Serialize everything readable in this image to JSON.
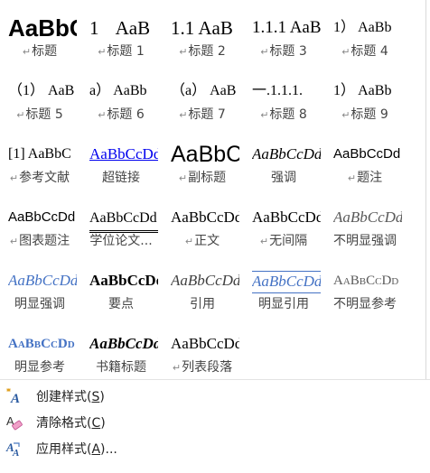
{
  "gallery": {
    "paragraph_mark": "↵",
    "styles": [
      {
        "preview": "AaBbC",
        "label": "标题",
        "mark": true
      },
      {
        "preview": "1 AaB",
        "label": "标题 1",
        "mark": true
      },
      {
        "preview": "1.1 AaB",
        "label": "标题 2",
        "mark": true
      },
      {
        "preview": "1.1.1 AaB",
        "label": "标题 3",
        "mark": true
      },
      {
        "preview": "1） AaBb",
        "label": "标题 4",
        "mark": true
      },
      {
        "preview": "（1） AaB",
        "label": "标题 5",
        "mark": true
      },
      {
        "preview": "a） AaBb",
        "label": "标题 6",
        "mark": true
      },
      {
        "preview": "（a） AaB",
        "label": "标题 7",
        "mark": true
      },
      {
        "preview": "一.1.1.1.",
        "label": "标题 8",
        "mark": true
      },
      {
        "preview": "1） AaBb",
        "label": "标题 9",
        "mark": true
      },
      {
        "preview": "[1] AaBbC",
        "label": "参考文献",
        "mark": true
      },
      {
        "preview": "AaBbCcDd",
        "label": "超链接",
        "mark": false
      },
      {
        "preview": "AaBbC",
        "label": "副标题",
        "mark": true
      },
      {
        "preview": "AaBbCcDd",
        "label": "强调",
        "mark": false
      },
      {
        "preview": "AaBbCcDd",
        "label": "题注",
        "mark": true
      },
      {
        "preview": "AaBbCcDd",
        "label": "图表题注",
        "mark": true
      },
      {
        "preview": "AaBbCcDd",
        "label": "学位论文...",
        "mark": false
      },
      {
        "preview": "AaBbCcDd",
        "label": "正文",
        "mark": true
      },
      {
        "preview": "AaBbCcDd",
        "label": "无间隔",
        "mark": true
      },
      {
        "preview": "AaBbCcDd",
        "label": "不明显强调",
        "mark": false
      },
      {
        "preview": "AaBbCcDd",
        "label": "明显强调",
        "mark": false
      },
      {
        "preview": "AaBbCcDd",
        "label": "要点",
        "mark": false
      },
      {
        "preview": "AaBbCcDd",
        "label": "引用",
        "mark": false
      },
      {
        "preview": "AaBbCcDd",
        "label": "明显引用",
        "mark": false
      },
      {
        "preview": "AaBbCcDd",
        "label": "不明显参考",
        "mark": false
      },
      {
        "preview": "AaBbCcDd",
        "label": "明显参考",
        "mark": false
      },
      {
        "preview": "AaBbCcDd",
        "label": "书籍标题",
        "mark": false
      },
      {
        "preview": "AaBbCcDd",
        "label": "列表段落",
        "mark": true
      }
    ]
  },
  "menu": {
    "create_style": {
      "label": "创建样式(",
      "key": "S",
      "suffix": ")"
    },
    "clear_format": {
      "label": "清除格式(",
      "key": "C",
      "suffix": ")"
    },
    "apply_style": {
      "label": "应用样式(",
      "key": "A",
      "suffix": ")..."
    }
  }
}
